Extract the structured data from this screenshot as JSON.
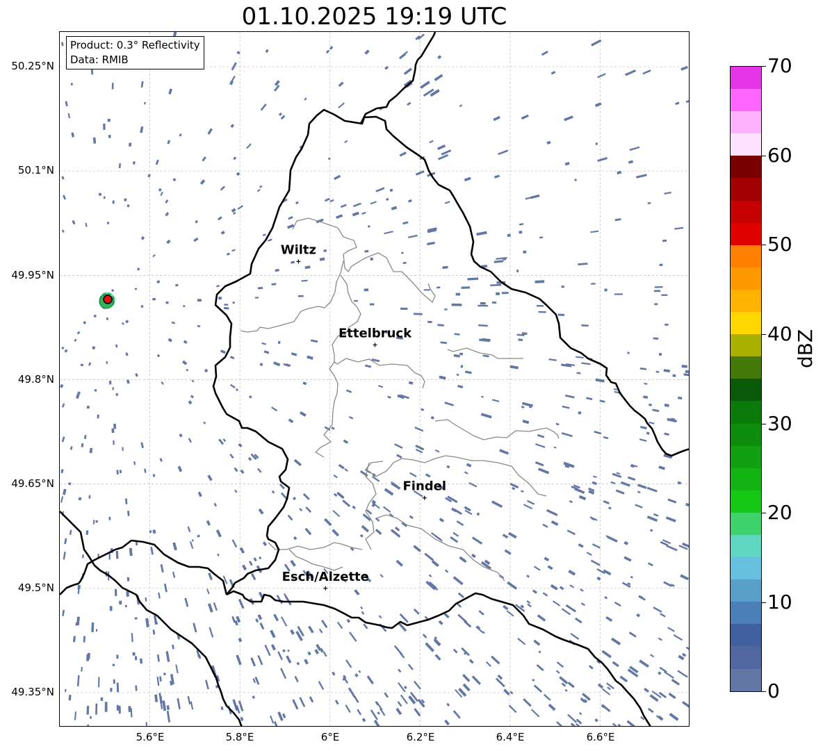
{
  "title": "01.10.2025 19:19 UTC",
  "info": {
    "product": "Product: 0.3° Reflectivity",
    "data": "Data: RMIB"
  },
  "map": {
    "lon_range": [
      5.4,
      6.8
    ],
    "lat_range": [
      49.3,
      50.3
    ],
    "lat_ticks": [
      "50.25°N",
      "50.1°N",
      "49.95°N",
      "49.8°N",
      "49.65°N",
      "49.5°N",
      "49.35°N"
    ],
    "lon_ticks": [
      "5.6°E",
      "5.8°E",
      "6°E",
      "6.2°E",
      "6.4°E",
      "6.6°E"
    ],
    "cities": [
      {
        "name": "Wiltz",
        "lon": 5.93,
        "lat": 49.97
      },
      {
        "name": "Ettelbruck",
        "lon": 6.1,
        "lat": 49.85
      },
      {
        "name": "Findel",
        "lon": 6.21,
        "lat": 49.63
      },
      {
        "name": "Esch/Alzette",
        "lon": 5.99,
        "lat": 49.5
      }
    ],
    "radar_site": {
      "lon": 5.505,
      "lat": 49.914
    },
    "echo_color": "#6377a4",
    "border_color": "#000000",
    "canton_color": "#888888"
  },
  "colorbar": {
    "label": "dBZ",
    "ticks": [
      "70",
      "60",
      "50",
      "40",
      "30",
      "20",
      "10",
      "0"
    ],
    "colors_top_down": [
      "#e635e6",
      "#ff66ff",
      "#ffb3ff",
      "#ffe0ff",
      "#7a0000",
      "#a00000",
      "#c40000",
      "#e00000",
      "#ff7f00",
      "#ff9900",
      "#ffb300",
      "#ffd700",
      "#aab000",
      "#447a0a",
      "#085a08",
      "#0a7a0a",
      "#0e8c0e",
      "#11a011",
      "#13b313",
      "#14c814",
      "#3ed36a",
      "#5fd6c0",
      "#66c0dd",
      "#58a0c8",
      "#4a7fb8",
      "#4060a0",
      "#5266a0",
      "#6377a4"
    ]
  }
}
